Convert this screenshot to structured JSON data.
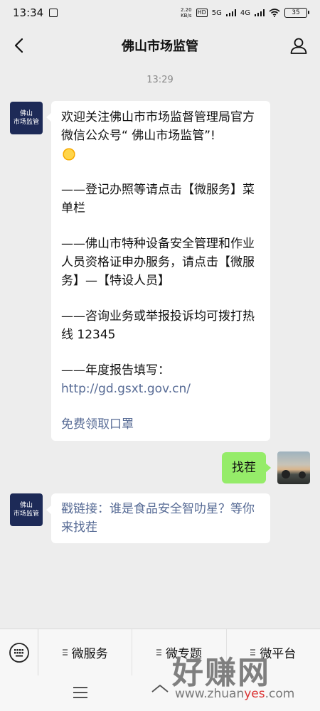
{
  "status_bar": {
    "time": "13:34",
    "net_speed_value": "2.20",
    "net_speed_unit": "KB/s",
    "hd_badge": "HD",
    "network_a": "5G",
    "network_b": "4G",
    "battery": "35"
  },
  "nav": {
    "title": "佛山市场监管"
  },
  "chat": {
    "timestamp": "13:29",
    "official_avatar_lines": [
      "佛山",
      "市场监管"
    ],
    "message1": {
      "intro": "欢迎关注佛山市市场监督管理局官方微信公众号“ 佛山市场监管”!",
      "p1": "——登记办照等请点击【微服务】菜单栏",
      "p2": "——佛山市特种设备安全管理和作业人员资格证申办服务，请点击【微服务】—【特设人员】",
      "p3": "——咨询业务或举报投诉均可拨打热线 12345",
      "p4_prefix": "——年度报告填写：",
      "p4_link": "http://gd.gsxt.gov.cn/",
      "p5_link": "免费领取口罩"
    },
    "reply": "找茬",
    "message2": {
      "link": "戳链接：谁是食品安全智叻星？等你来找茬"
    }
  },
  "bottom_menu": {
    "items": [
      "微服务",
      "微专题",
      "微平台"
    ]
  },
  "watermark": {
    "big": "好赚网",
    "small_a": "www.zhuan",
    "small_b": "yes",
    "small_c": ".com"
  },
  "colors": {
    "chat_bg": "#ededed",
    "bubble_left": "#ffffff",
    "bubble_right": "#95ec69",
    "link": "#576b95",
    "official_avatar": "#1d2a57"
  }
}
